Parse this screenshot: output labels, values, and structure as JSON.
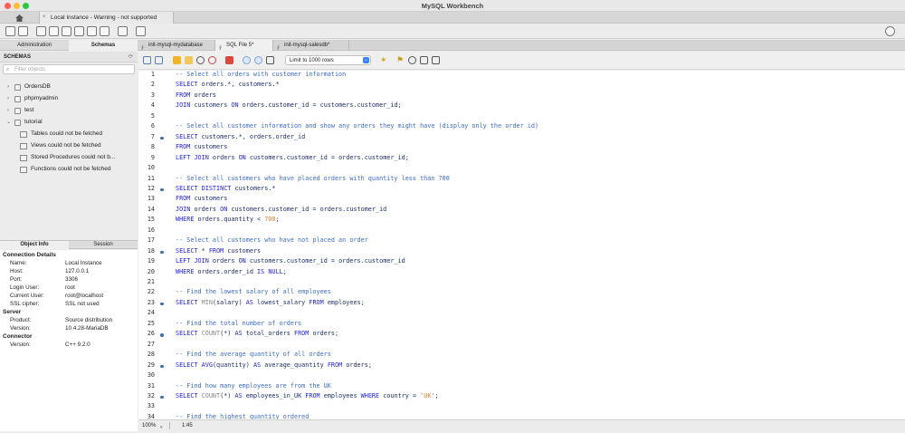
{
  "window": {
    "title": "MySQL Workbench"
  },
  "connection_tab": {
    "label": "Local Instance - Warning - not supported"
  },
  "left_tabs": {
    "administration": "Administration",
    "schemas": "Schemas"
  },
  "editor_tabs": [
    {
      "label": "init-mysql-mydatabase"
    },
    {
      "label": "SQL File 5*"
    },
    {
      "label": "init-mysql-salesdb*"
    }
  ],
  "schemas": {
    "header": "SCHEMAS",
    "filter_placeholder": "Filter objects",
    "items": [
      {
        "name": "OrdersDB",
        "expanded": false
      },
      {
        "name": "phpmyadmin",
        "expanded": false
      },
      {
        "name": "test",
        "expanded": false
      },
      {
        "name": "tutorial",
        "expanded": true
      }
    ],
    "tutorial_children": [
      "Tables could not be fetched",
      "Views could not be fetched",
      "Stored Procedures could not b...",
      "Functions could not be fetched"
    ]
  },
  "info_tabs": {
    "object_info": "Object Info",
    "session": "Session"
  },
  "info": {
    "connection_details": "Connection Details",
    "name_k": "Name:",
    "name_v": "Local Instance",
    "host_k": "Host:",
    "host_v": "127.0.0.1",
    "port_k": "Port:",
    "port_v": "3306",
    "login_k": "Login User:",
    "login_v": "root",
    "current_k": "Current User:",
    "current_v": "root@localhost",
    "ssl_k": "SSL cipher:",
    "ssl_v": "SSL not used",
    "server": "Server",
    "product_k": "Product:",
    "product_v": "Source distribution",
    "version_k": "Version:",
    "version_v": "10.4.28-MariaDB",
    "connector": "Connector",
    "cversion_k": "Version:",
    "cversion_v": "C++ 9.2.0"
  },
  "sql_toolbar": {
    "limit_label": "Limit to 1000 rows"
  },
  "code_lines": [
    {
      "n": "1",
      "dot": false,
      "html": "<span class='cm'>-- Select all orders with customer information</span>"
    },
    {
      "n": "2",
      "dot": false,
      "html": "<span class='kw'>SELECT</span> orders.*, customers.*"
    },
    {
      "n": "3",
      "dot": false,
      "html": "<span class='kw'>FROM</span> orders"
    },
    {
      "n": "4",
      "dot": false,
      "html": "<span class='kw'>JOIN</span> customers <span class='kw'>ON</span> orders.customer_id = customers.customer_id;"
    },
    {
      "n": "5",
      "dot": false,
      "html": ""
    },
    {
      "n": "6",
      "dot": false,
      "html": "<span class='cm'>-- Select all customer information and show any orders they might have (display only the order id)</span>"
    },
    {
      "n": "7",
      "dot": true,
      "html": "<span class='kw'>SELECT</span> customers.*, orders.order_id"
    },
    {
      "n": "8",
      "dot": false,
      "html": "<span class='kw'>FROM</span> customers"
    },
    {
      "n": "9",
      "dot": false,
      "html": "<span class='kw'>LEFT JOIN</span> orders <span class='kw'>ON</span> customers.customer_id = orders.customer_id;"
    },
    {
      "n": "10",
      "dot": false,
      "html": ""
    },
    {
      "n": "11",
      "dot": false,
      "html": "<span class='cm'>-- Select all customers who have placed orders with quantity less than 700</span>"
    },
    {
      "n": "12",
      "dot": true,
      "html": "<span class='kw'>SELECT DISTINCT</span> customers.*"
    },
    {
      "n": "13",
      "dot": false,
      "html": "<span class='kw'>FROM</span> customers"
    },
    {
      "n": "14",
      "dot": false,
      "html": "<span class='kw'>JOIN</span> orders <span class='kw'>ON</span> customers.customer_id = orders.customer_id"
    },
    {
      "n": "15",
      "dot": false,
      "html": "<span class='kw'>WHERE</span> orders.quantity &lt; <span class='str'>700</span>;"
    },
    {
      "n": "16",
      "dot": false,
      "html": ""
    },
    {
      "n": "17",
      "dot": false,
      "html": "<span class='cm'>-- Select all customers who have not placed an order</span>"
    },
    {
      "n": "18",
      "dot": true,
      "html": "<span class='kw'>SELECT</span> * <span class='kw'>FROM</span> customers"
    },
    {
      "n": "19",
      "dot": false,
      "html": "<span class='kw'>LEFT JOIN</span> orders <span class='kw'>ON</span> customers.customer_id = orders.customer_id"
    },
    {
      "n": "20",
      "dot": false,
      "html": "<span class='kw'>WHERE</span> orders.order_id <span class='kw'>IS NULL</span>;"
    },
    {
      "n": "21",
      "dot": false,
      "html": ""
    },
    {
      "n": "22",
      "dot": false,
      "html": "<span class='cm'>-- Find the lowest salary of all employees</span>"
    },
    {
      "n": "23",
      "dot": true,
      "html": "<span class='kw'>SELECT</span> <span class='fn'>MIN</span>(salary) <span class='kw'>AS</span> lowest_salary <span class='kw'>FROM</span> employees;"
    },
    {
      "n": "24",
      "dot": false,
      "html": ""
    },
    {
      "n": "25",
      "dot": false,
      "html": "<span class='cm'>-- Find the total number of orders</span>"
    },
    {
      "n": "26",
      "dot": true,
      "html": "<span class='kw'>SELECT</span> <span class='fn'>COUNT</span>(*) <span class='kw'>AS</span> total_orders <span class='kw'>FROM</span> orders;"
    },
    {
      "n": "27",
      "dot": false,
      "html": ""
    },
    {
      "n": "28",
      "dot": false,
      "html": "<span class='cm'>-- Find the average quantity of all orders</span>"
    },
    {
      "n": "29",
      "dot": true,
      "html": "<span class='kw'>SELECT</span> <span class='kw'>AVG</span>(quantity) <span class='kw'>AS</span> average_quantity <span class='kw'>FROM</span> orders;"
    },
    {
      "n": "30",
      "dot": false,
      "html": ""
    },
    {
      "n": "31",
      "dot": false,
      "html": "<span class='cm'>-- Find how many employees are from the UK</span>"
    },
    {
      "n": "32",
      "dot": true,
      "html": "<span class='kw'>SELECT</span> <span class='fn'>COUNT</span>(*) <span class='kw'>AS</span> employees_in_UK <span class='kw'>FROM</span> employees <span class='kw'>WHERE</span> country = <span class='str'>'UK'</span>;"
    },
    {
      "n": "33",
      "dot": false,
      "html": ""
    },
    {
      "n": "34",
      "dot": false,
      "html": "<span class='cm'>-- Find the highest quantity ordered</span>"
    }
  ],
  "status": {
    "zoom": "100%",
    "position": "1:45"
  },
  "colors": {
    "accent": "#3b82f6",
    "keyword": "#1f1fd6",
    "comment": "#3b6cc8",
    "string": "#d4803a"
  }
}
